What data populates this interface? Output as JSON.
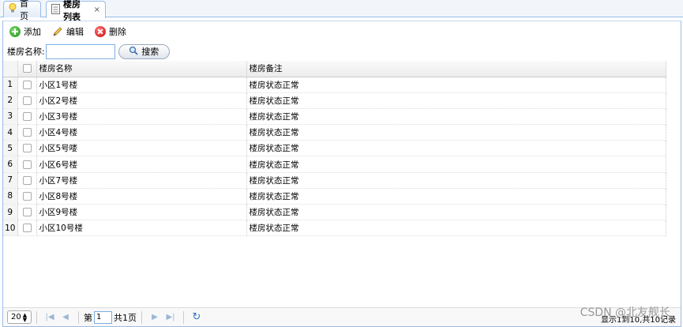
{
  "tabs": [
    {
      "label": "首页",
      "icon": "lightbulb-icon",
      "active": false
    },
    {
      "label": "楼房列表",
      "icon": "document-icon",
      "active": true,
      "close": "×"
    }
  ],
  "toolbar": {
    "add_label": "添加",
    "edit_label": "编辑",
    "delete_label": "删除"
  },
  "search": {
    "field_label": "楼房名称:",
    "value": "",
    "button_label": "搜索"
  },
  "grid": {
    "columns": [
      "楼房名称",
      "楼房备注"
    ],
    "rows": [
      {
        "num": "1",
        "name": "小区1号楼",
        "note": "楼房状态正常"
      },
      {
        "num": "2",
        "name": "小区2号楼",
        "note": "楼房状态正常"
      },
      {
        "num": "3",
        "name": "小区3号楼",
        "note": "楼房状态正常"
      },
      {
        "num": "4",
        "name": "小区4号楼",
        "note": "楼房状态正常"
      },
      {
        "num": "5",
        "name": "小区5号喽",
        "note": "楼房状态正常"
      },
      {
        "num": "6",
        "name": "小区6号楼",
        "note": "楼房状态正常"
      },
      {
        "num": "7",
        "name": "小区7号楼",
        "note": "楼房状态正常"
      },
      {
        "num": "8",
        "name": "小区8号楼",
        "note": "楼房状态正常"
      },
      {
        "num": "9",
        "name": "小区9号楼",
        "note": "楼房状态正常"
      },
      {
        "num": "10",
        "name": "小区10号楼",
        "note": "楼房状态正常"
      }
    ]
  },
  "pager": {
    "page_size": "20",
    "page_prefix": "第",
    "page_value": "1",
    "page_suffix": "共1页",
    "info": "显示1到10,共10记录"
  },
  "watermark": "CSDN @北友舰长",
  "colors": {
    "border": "#99bbe8",
    "tab_bg": "#f2f6fb",
    "header_bg": "#ececec"
  }
}
